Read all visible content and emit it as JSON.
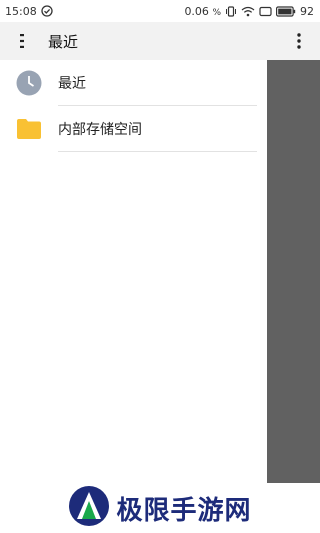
{
  "status_bar": {
    "time": "15:08",
    "data_rate": "0.06",
    "data_unit": "%",
    "battery": "92",
    "icons": [
      "check-circle-icon",
      "vibrate-icon",
      "wifi-icon",
      "signal-icon",
      "battery-icon"
    ]
  },
  "appbar": {
    "title": "最近",
    "menu_icon": "menu-icon",
    "overflow_icon": "more-vert-icon"
  },
  "drawer": {
    "items": [
      {
        "label": "最近",
        "icon": "clock-icon"
      },
      {
        "label": "内部存储空间",
        "icon": "folder-icon"
      }
    ]
  },
  "watermark": {
    "text": "极限手游网"
  },
  "colors": {
    "appbar_bg": "#f2f2f2",
    "scrim": "#616161",
    "clock_icon": "#98a3b3",
    "folder_icon": "#f9c133",
    "watermark_text": "#1d2b7a"
  }
}
